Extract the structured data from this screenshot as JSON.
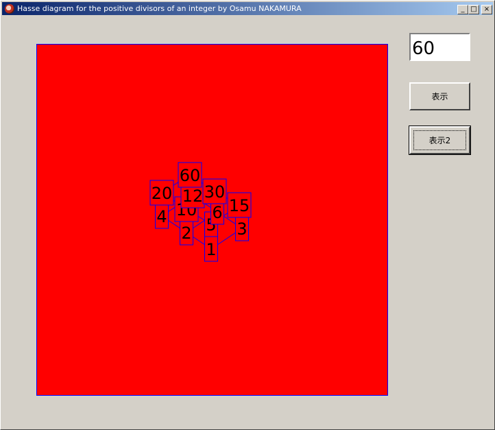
{
  "window": {
    "title": "Hasse diagram for the positive divisors of an integer by Osamu NAKAMURA",
    "app_icon": "app-icon",
    "controls": {
      "minimize": "_",
      "maximize": "□",
      "close": "×"
    }
  },
  "input": {
    "value": "60"
  },
  "buttons": {
    "show_label": "表示",
    "show2_label": "表示2"
  },
  "colors": {
    "canvas_bg": "#ff0000",
    "line": "#0000ff",
    "window_bg": "#d4d0c8",
    "title_bar": "#0a246a"
  },
  "diagram": {
    "number": 60,
    "divisors": [
      "1",
      "2",
      "3",
      "4",
      "5",
      "6",
      "10",
      "12",
      "15",
      "20",
      "30",
      "60"
    ],
    "edges": [
      [
        "1",
        "2"
      ],
      [
        "1",
        "3"
      ],
      [
        "1",
        "5"
      ],
      [
        "2",
        "4"
      ],
      [
        "2",
        "6"
      ],
      [
        "2",
        "10"
      ],
      [
        "3",
        "6"
      ],
      [
        "3",
        "15"
      ],
      [
        "5",
        "10"
      ],
      [
        "5",
        "15"
      ],
      [
        "4",
        "12"
      ],
      [
        "4",
        "20"
      ],
      [
        "6",
        "12"
      ],
      [
        "6",
        "30"
      ],
      [
        "10",
        "20"
      ],
      [
        "10",
        "30"
      ],
      [
        "15",
        "30"
      ],
      [
        "12",
        "60"
      ],
      [
        "20",
        "60"
      ],
      [
        "30",
        "60"
      ]
    ]
  }
}
